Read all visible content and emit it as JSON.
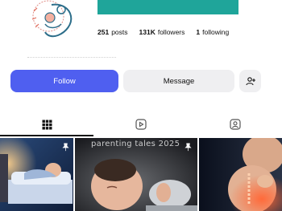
{
  "profile": {
    "stats": [
      {
        "value": "251",
        "label": "posts"
      },
      {
        "value": "131K",
        "label": "followers"
      },
      {
        "value": "1",
        "label": "following"
      }
    ],
    "accent": "#1fa59a"
  },
  "actions": {
    "follow_label": "Follow",
    "message_label": "Message",
    "follow_color": "#4f5ff0"
  },
  "tabs": [
    {
      "icon": "grid-icon",
      "active": true
    },
    {
      "icon": "reels-icon",
      "active": false
    },
    {
      "icon": "tagged-icon",
      "active": false
    }
  ],
  "posts": [
    {
      "icon": "pin-icon",
      "pinned": true
    },
    {
      "overlay_text": "parenting tales 2025",
      "icon": "pin-icon",
      "pinned": true
    },
    {
      "pinned": false
    }
  ]
}
